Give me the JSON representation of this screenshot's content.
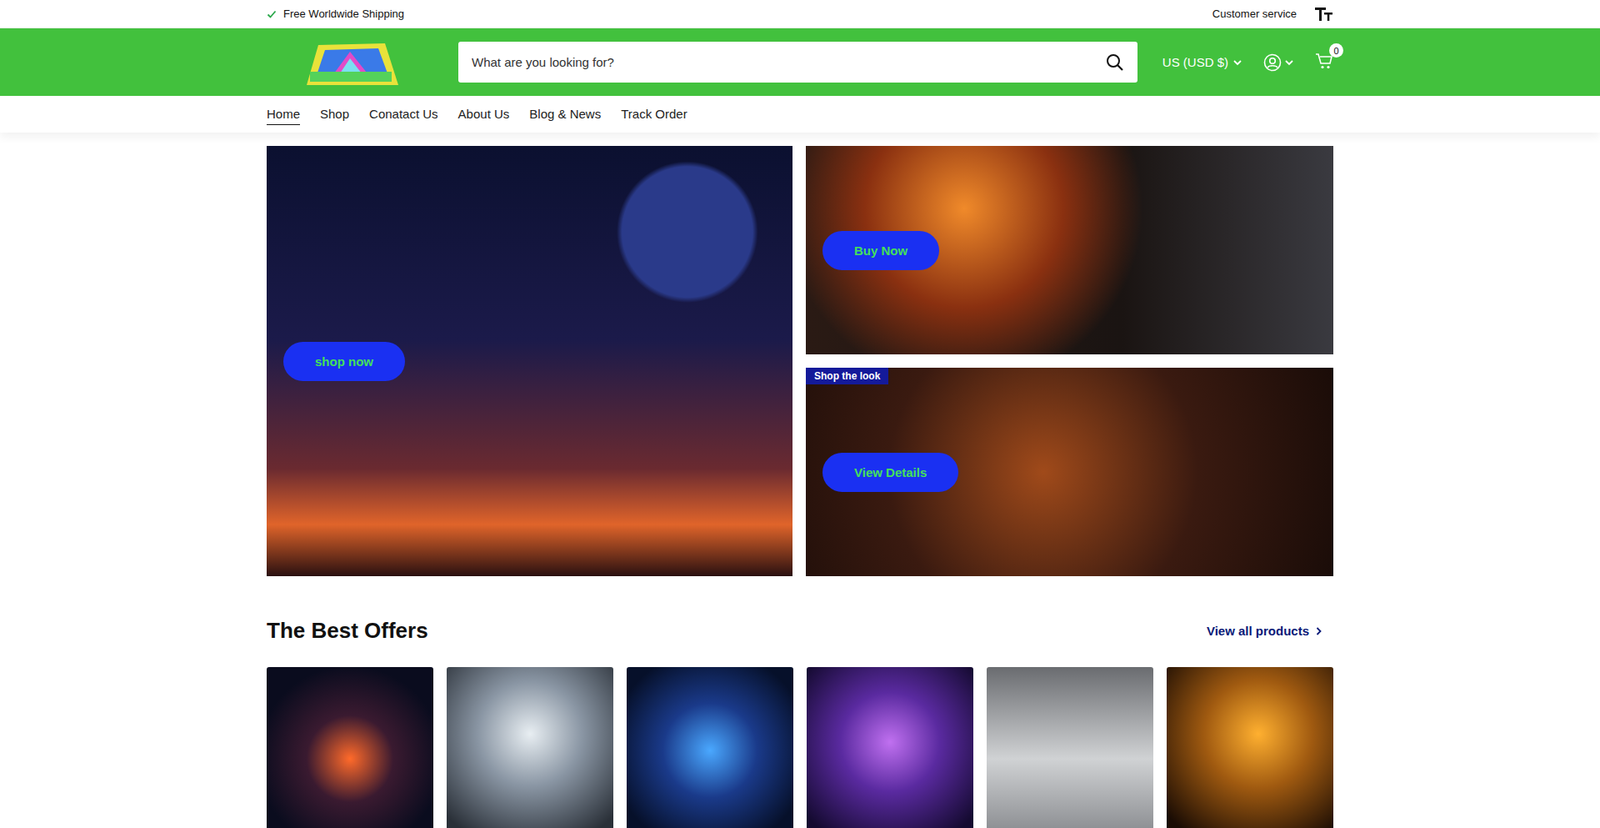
{
  "top_bar": {
    "shipping": "Free Worldwide Shipping",
    "customer_service": "Customer service"
  },
  "search": {
    "placeholder": "What are you looking for?"
  },
  "currency": "US (USD $)",
  "cart": {
    "count": "0"
  },
  "nav": [
    {
      "label": "Home",
      "selected": true
    },
    {
      "label": "Shop",
      "selected": false
    },
    {
      "label": "Conatact Us",
      "selected": false
    },
    {
      "label": "About Us",
      "selected": false
    },
    {
      "label": "Blog & News",
      "selected": false
    },
    {
      "label": "Track Order",
      "selected": false
    }
  ],
  "hero": {
    "main_button": "shop now",
    "promo_button": "Buy Now",
    "beam_badge": "Shop the look",
    "beam_button": "View Details"
  },
  "offers": {
    "title": "The Best Offers",
    "link": "View all products"
  }
}
